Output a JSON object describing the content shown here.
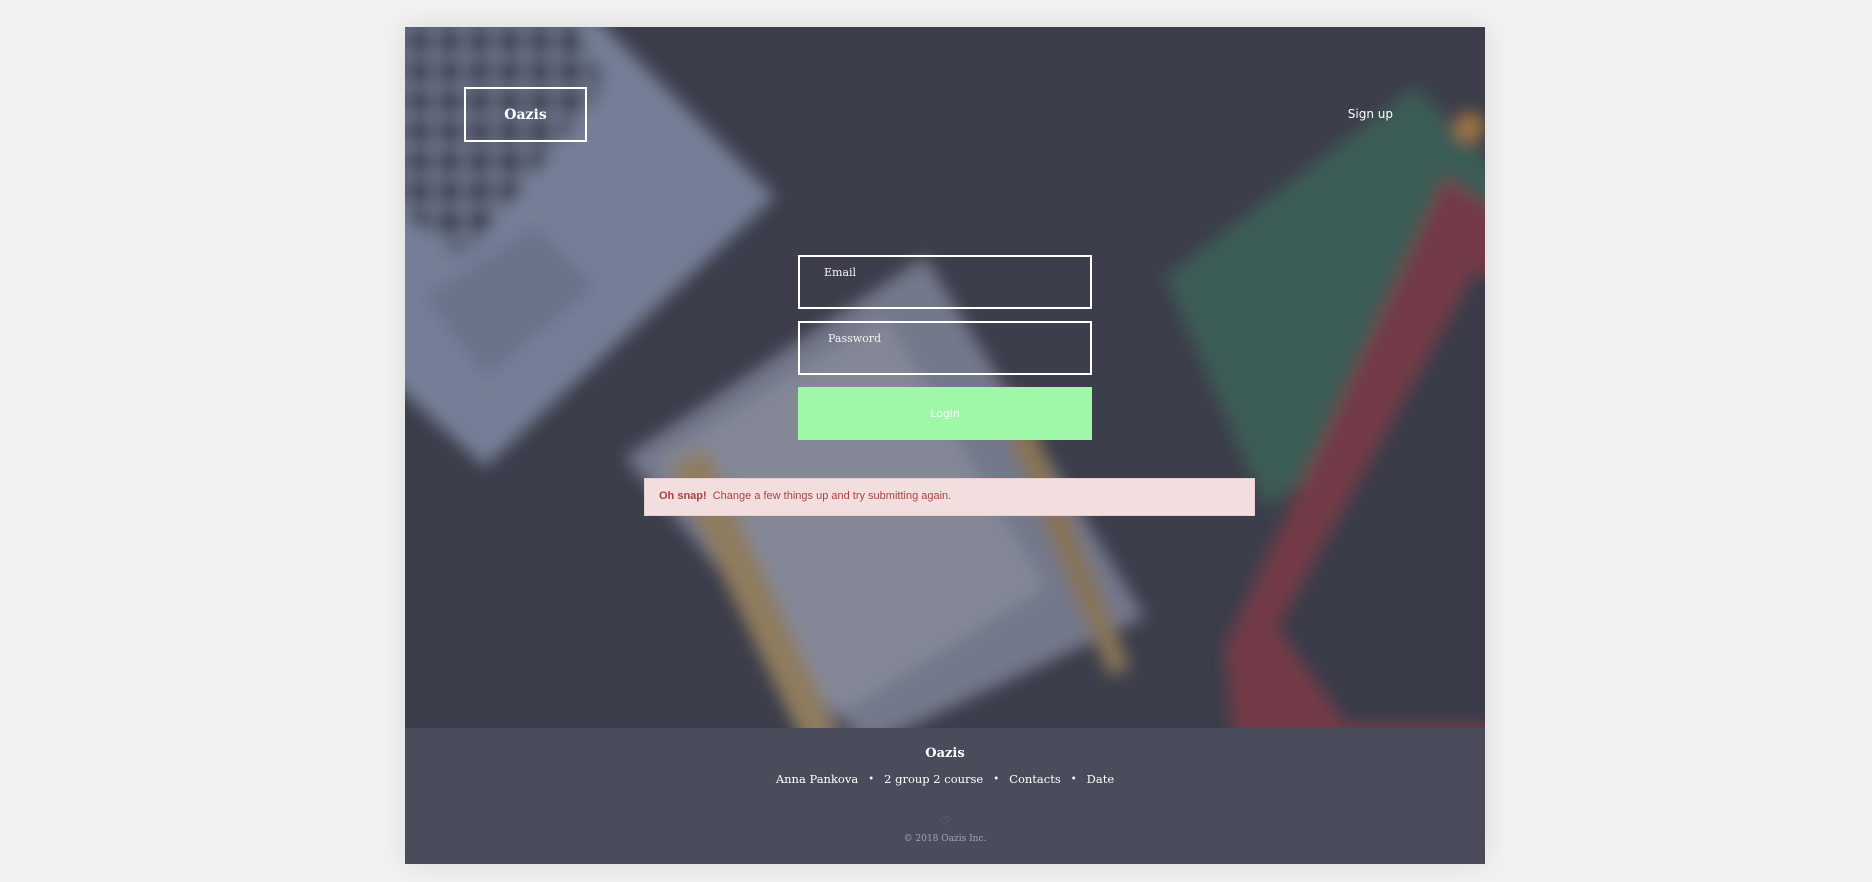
{
  "header": {
    "logo": "Oazis",
    "signup_label": "Sign up"
  },
  "login_form": {
    "email_placeholder": "Email",
    "password_placeholder": "Password",
    "login_label": "Login",
    "login_button_color": "#9ff7a8"
  },
  "alert": {
    "strong": "Oh snap!",
    "message": "Change a few things up and try submitting again.",
    "background_color": "#f2dede",
    "text_color": "#a94442"
  },
  "footer": {
    "brand": "Oazis",
    "links": [
      "Anna Pankova",
      "2 group 2 course",
      "Contacts",
      "Date"
    ],
    "separator": "•",
    "icon": "heart-icon",
    "copyright": "© 2018 Oazis Inc."
  }
}
